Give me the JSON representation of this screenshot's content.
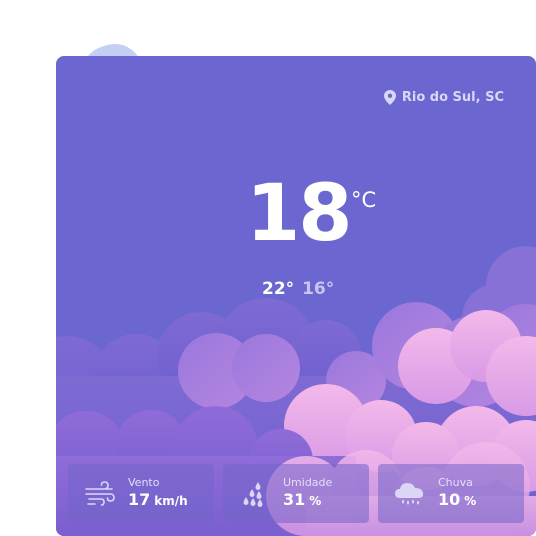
{
  "location": {
    "name": "Rio do Sul, SC",
    "icon": "map-pin-icon"
  },
  "current": {
    "temperature": "18",
    "unit": "°C"
  },
  "range": {
    "max": "22°",
    "min": "16°"
  },
  "stats": [
    {
      "label": "Vento",
      "value": "17",
      "unit": "km/h",
      "icon": "wind-icon"
    },
    {
      "label": "Umidade",
      "value": "31",
      "unit": "%",
      "icon": "humidity-drops-icon"
    },
    {
      "label": "Chuva",
      "value": "10",
      "unit": "%",
      "icon": "rain-cloud-icon"
    }
  ],
  "colors": {
    "card_bg": "#6b66d0",
    "deco_cloud": "#c5cff4",
    "pink_cloud": "#f0b6e8",
    "stat_bg": "rgba(114,100,200,0.55)"
  }
}
